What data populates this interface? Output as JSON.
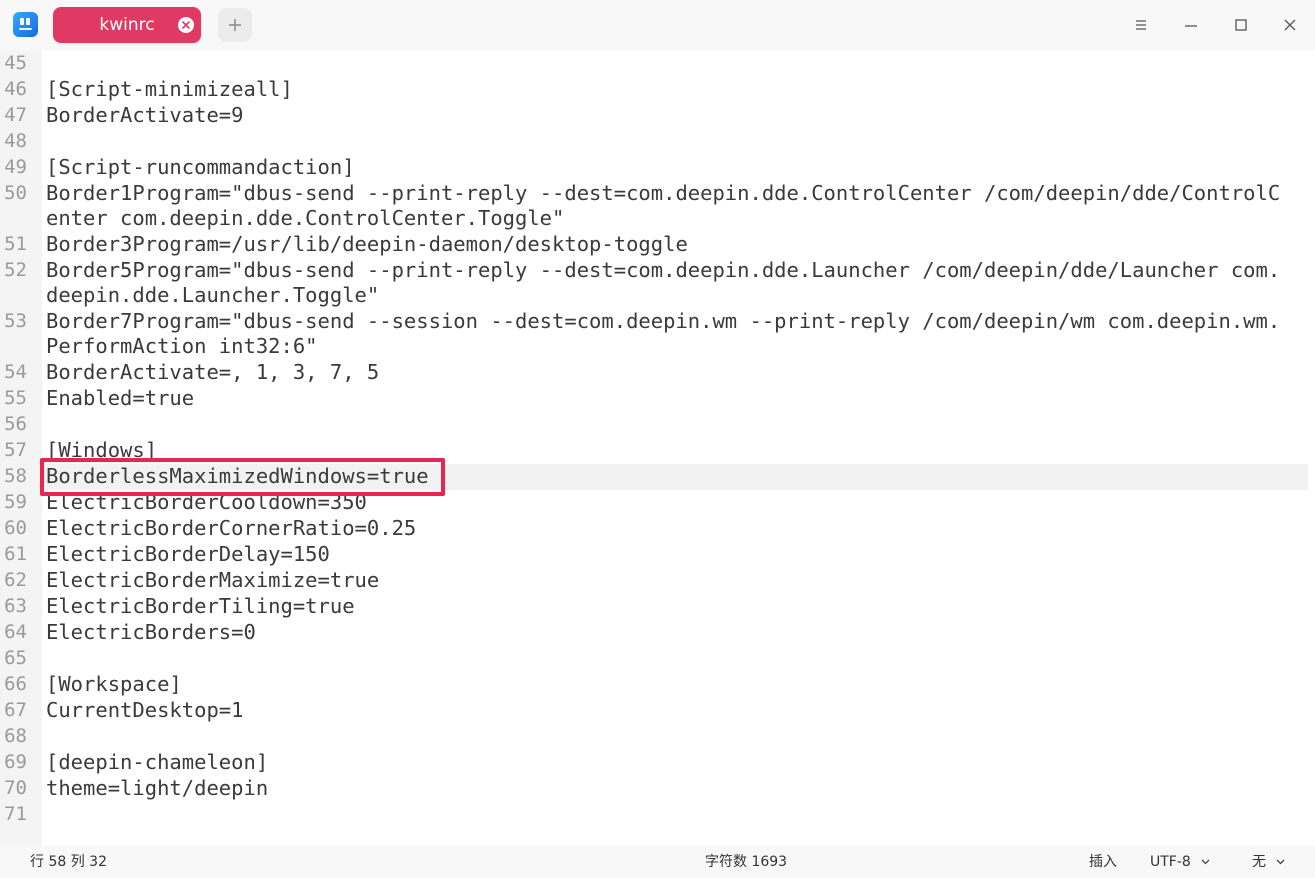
{
  "tab": {
    "title": "kwinrc"
  },
  "icons": {
    "app": "text-editor-icon",
    "tab_close": "close-circle-icon",
    "new_tab": "plus-icon",
    "menu": "hamburger-menu-icon",
    "minimize": "minimize-icon",
    "maximize": "maximize-icon",
    "close": "close-icon"
  },
  "colors": {
    "tab_active": "#e03a64",
    "highlight_box": "#e8264f",
    "line_number": "#9a9a9a",
    "code_text": "#3a3a3a"
  },
  "editor": {
    "current_line": 58,
    "line_numbers": [
      "45",
      "46",
      "47",
      "48",
      "49",
      "50",
      "51",
      "52",
      "53",
      "54",
      "55",
      "56",
      "57",
      "58",
      "59",
      "60",
      "61",
      "62",
      "63",
      "64",
      "65",
      "66",
      "67",
      "68",
      "69",
      "70",
      "71"
    ],
    "lines": [
      "",
      "[Script-minimizeall]",
      "BorderActivate=9",
      "",
      "[Script-runcommandaction]",
      "Border1Program=\"dbus-send --print-reply --dest=com.deepin.dde.ControlCenter /com/deepin/dde/ControlC",
      "enter com.deepin.dde.ControlCenter.Toggle\"",
      "Border3Program=/usr/lib/deepin-daemon/desktop-toggle",
      "Border5Program=\"dbus-send --print-reply --dest=com.deepin.dde.Launcher /com/deepin/dde/Launcher com.",
      "deepin.dde.Launcher.Toggle\"",
      "Border7Program=\"dbus-send --session --dest=com.deepin.wm --print-reply /com/deepin/wm com.deepin.wm.",
      "PerformAction int32:6\"",
      "BorderActivate=, 1, 3, 7, 5",
      "Enabled=true",
      "",
      "[Windows]",
      "BorderlessMaximizedWindows=true",
      "ElectricBorderCooldown=350",
      "ElectricBorderCornerRatio=0.25",
      "ElectricBorderDelay=150",
      "ElectricBorderMaximize=true",
      "ElectricBorderTiling=true",
      "ElectricBorders=0",
      "",
      "[Workspace]",
      "CurrentDesktop=1",
      "",
      "[deepin-chameleon]",
      "theme=light/deepin",
      ""
    ]
  },
  "status": {
    "position": "行 58  列 32",
    "char_count": "字符数 1693",
    "insert_mode": "插入",
    "encoding": "UTF-8",
    "highlight_mode": "无"
  }
}
